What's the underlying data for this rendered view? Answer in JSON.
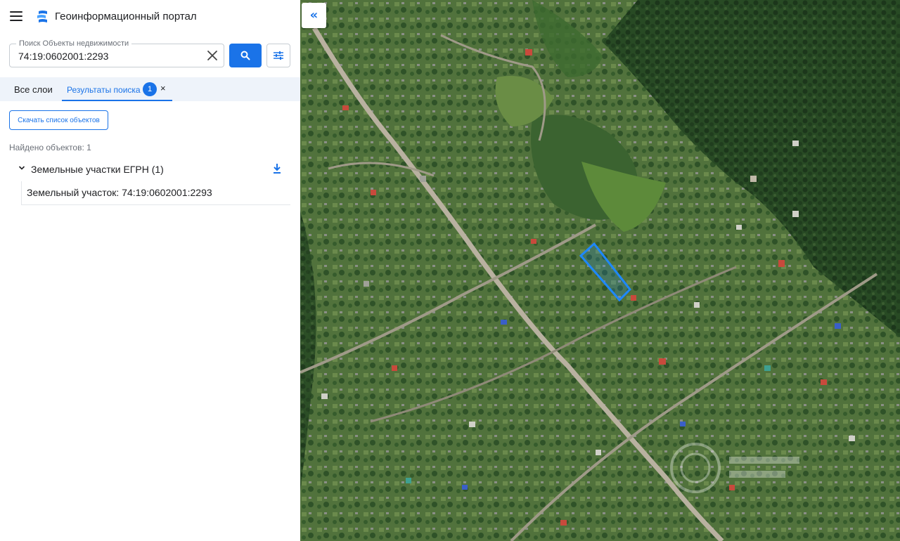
{
  "header": {
    "title": "Геоинформационный портал",
    "menu_icon": "hamburger-menu-icon",
    "logo_icon": "portal-logo-icon"
  },
  "search": {
    "legend": "Поиск Объекты недвижимости",
    "value": "74:19:0602001:2293",
    "clear_icon": "close-icon",
    "search_icon": "search-icon",
    "filter_icon": "sliders-icon"
  },
  "tabs": {
    "all_layers": "Все слои",
    "results": "Результаты поиска",
    "results_badge": "1",
    "close_glyph": "×"
  },
  "results": {
    "download_button": "Скачать список объектов",
    "found_count": "Найдено объектов: 1",
    "group_label": "Земельные участки ЕГРН (1)",
    "items": [
      {
        "label": "Земельный участок: 74:19:0602001:2293"
      }
    ]
  },
  "map": {
    "collapse_glyph": "«",
    "highlight_color": "#1e88ff",
    "accent_color": "#1a73e8"
  }
}
